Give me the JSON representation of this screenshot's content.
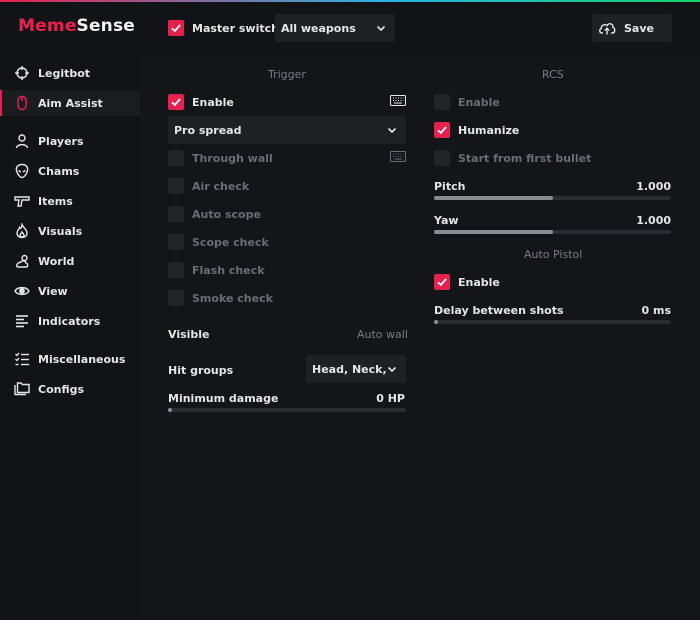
{
  "app": {
    "logo_part1": "Meme",
    "logo_part2": "Sense"
  },
  "sidebar": {
    "items": [
      {
        "label": "Legitbot",
        "icon": "crosshair-icon"
      },
      {
        "label": "Aim Assist",
        "icon": "mouse-icon",
        "active": true
      },
      {
        "label": "Players",
        "icon": "user-icon"
      },
      {
        "label": "Chams",
        "icon": "alien-head-icon"
      },
      {
        "label": "Items",
        "icon": "pistol-icon"
      },
      {
        "label": "Visuals",
        "icon": "flame-icon"
      },
      {
        "label": "World",
        "icon": "cloud-sun-icon"
      },
      {
        "label": "View",
        "icon": "eye-icon"
      },
      {
        "label": "Indicators",
        "icon": "text-lines-icon"
      },
      {
        "label": "Miscellaneous",
        "icon": "checklist-icon"
      },
      {
        "label": "Configs",
        "icon": "folders-icon"
      }
    ]
  },
  "header": {
    "master_switch_label": "Master switch",
    "master_switch_checked": true,
    "weapon_select": "All weapons",
    "save_label": "Save"
  },
  "trigger": {
    "heading": "Trigger",
    "enable_label": "Enable",
    "enable_checked": true,
    "mode_select": "Pro spread",
    "through_wall": "Through wall",
    "air_check": "Air check",
    "auto_scope": "Auto scope",
    "scope_check": "Scope check",
    "flash_check": "Flash check",
    "smoke_check": "Smoke check",
    "visible_label": "Visible",
    "visible_value": "Auto wall",
    "hit_groups_label": "Hit groups",
    "hit_groups_value": "Head, Neck, C",
    "min_damage_label": "Minimum damage",
    "min_damage_value": "0 HP",
    "min_damage_fraction": 0.0
  },
  "rcs": {
    "heading": "RCS",
    "enable_label": "Enable",
    "enable_checked": false,
    "humanize_label": "Humanize",
    "humanize_checked": true,
    "start_first_label": "Start from first bullet",
    "pitch_label": "Pitch",
    "pitch_value": "1.000",
    "pitch_fraction": 0.5,
    "yaw_label": "Yaw",
    "yaw_value": "1.000",
    "yaw_fraction": 0.5
  },
  "auto_pistol": {
    "heading": "Auto Pistol",
    "enable_label": "Enable",
    "enable_checked": true,
    "delay_label": "Delay between shots",
    "delay_value": "0 ms",
    "delay_fraction": 0.0
  },
  "colors": {
    "accent": "#e6214f",
    "background": "#121316",
    "panel": "#1f2024"
  }
}
